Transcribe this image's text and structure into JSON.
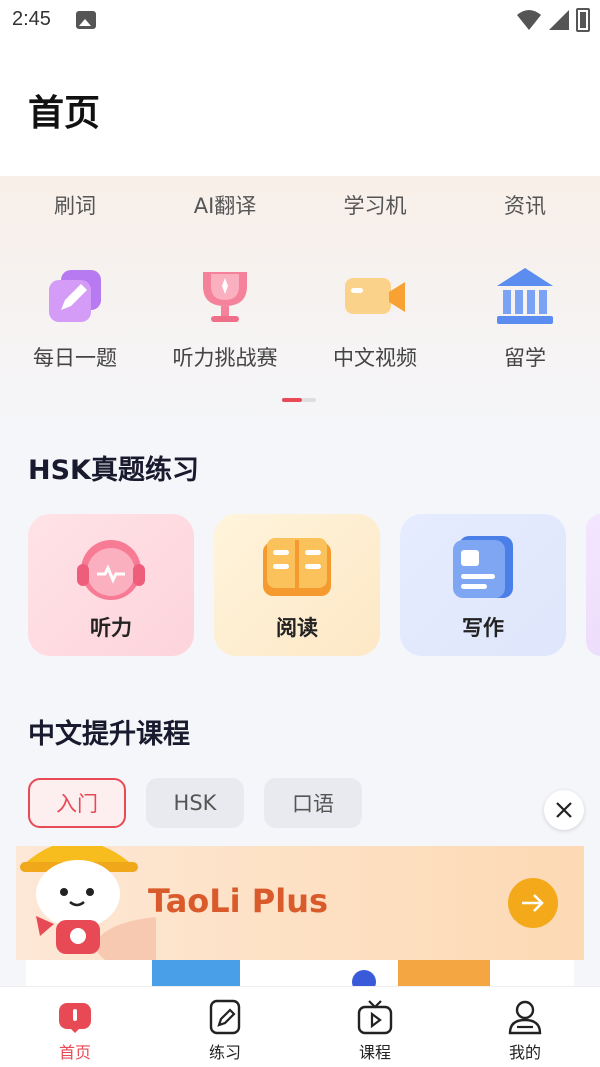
{
  "status": {
    "time": "2:45"
  },
  "header": {
    "title": "首页"
  },
  "quick_tabs": [
    "刷词",
    "AI翻译",
    "学习机",
    "资讯"
  ],
  "shortcuts": [
    {
      "label": "每日一题",
      "icon": "pencil-icon"
    },
    {
      "label": "听力挑战赛",
      "icon": "trophy-icon"
    },
    {
      "label": "中文视频",
      "icon": "video-camera-icon"
    },
    {
      "label": "留学",
      "icon": "bank-icon"
    }
  ],
  "hsk": {
    "title": "HSK真题练习",
    "cards": [
      {
        "label": "听力",
        "icon": "headphones-icon"
      },
      {
        "label": "阅读",
        "icon": "book-icon"
      },
      {
        "label": "写作",
        "icon": "document-icon"
      }
    ]
  },
  "courses": {
    "title": "中文提升课程",
    "filters": [
      "入门",
      "HSK",
      "口语"
    ],
    "selected_filter": "入门"
  },
  "banner": {
    "text": "TaoLi Plus"
  },
  "bottom_nav": {
    "items": [
      "首页",
      "练习",
      "课程",
      "我的"
    ],
    "active": "首页"
  },
  "colors": {
    "accent": "#e84a55",
    "banner_arrow": "#f4a91a"
  }
}
